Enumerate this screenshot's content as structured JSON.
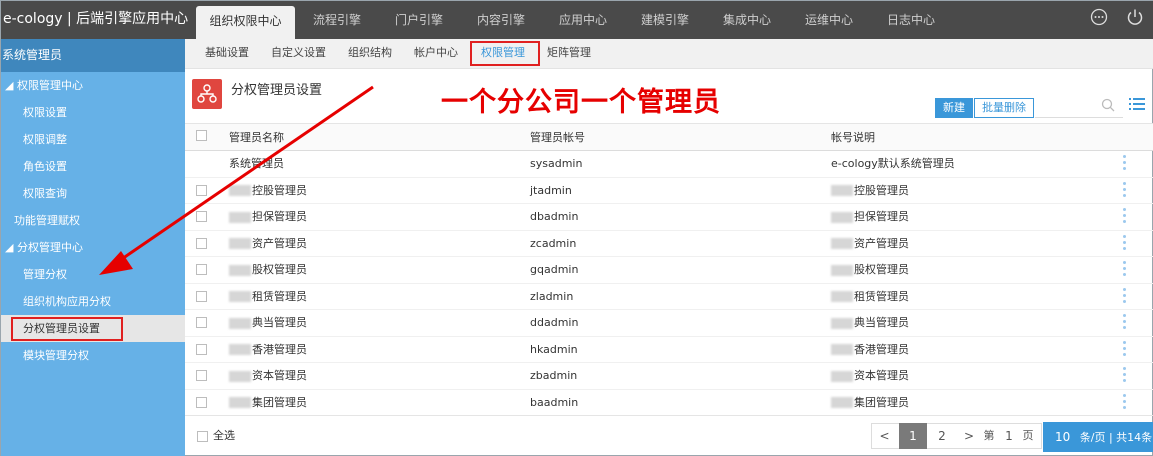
{
  "brand": "e-cology | 后端引擎应用中心",
  "top_tabs": [
    "组织权限中心",
    "流程引擎",
    "门户引擎",
    "内容引擎",
    "应用中心",
    "建模引擎",
    "集成中心",
    "运维中心",
    "日志中心"
  ],
  "sidebar": {
    "header": "系统管理员",
    "items": [
      {
        "label": "◢ 权限管理中心"
      },
      {
        "label": "权限设置"
      },
      {
        "label": "权限调整"
      },
      {
        "label": "角色设置"
      },
      {
        "label": "权限查询"
      },
      {
        "label": "功能管理赋权"
      },
      {
        "label": "◢ 分权管理中心"
      },
      {
        "label": "管理分权"
      },
      {
        "label": "组织机构应用分权"
      },
      {
        "label": "分权管理员设置"
      },
      {
        "label": "模块管理分权"
      }
    ]
  },
  "sub_tabs": [
    "基础设置",
    "自定义设置",
    "组织结构",
    "帐户中心",
    "权限管理",
    "矩阵管理"
  ],
  "page": {
    "title": "分权管理员设置",
    "annotation": "一个分公司一个管理员",
    "new_button": "新建",
    "batch_delete_button": "批量删除",
    "search_placeholder": ""
  },
  "table": {
    "columns": [
      "管理员名称",
      "管理员帐号",
      "帐号说明"
    ],
    "rows": [
      {
        "name": "系统管理员",
        "account": "sysadmin",
        "desc": "e-cology默认系统管理员"
      },
      {
        "name": "控股管理员",
        "account": "jtadmin",
        "desc": "控股管理员"
      },
      {
        "name": "担保管理员",
        "account": "dbadmin",
        "desc": "担保管理员"
      },
      {
        "name": "资产管理员",
        "account": "zcadmin",
        "desc": "资产管理员"
      },
      {
        "name": "股权管理员",
        "account": "gqadmin",
        "desc": "股权管理员"
      },
      {
        "name": "租赁管理员",
        "account": "zladmin",
        "desc": "租赁管理员"
      },
      {
        "name": "典当管理员",
        "account": "ddadmin",
        "desc": "典当管理员"
      },
      {
        "name": "香港管理员",
        "account": "hkadmin",
        "desc": "香港管理员"
      },
      {
        "name": "资本管理员",
        "account": "zbadmin",
        "desc": "资本管理员"
      },
      {
        "name": "集团管理员",
        "account": "baadmin",
        "desc": "集团管理员"
      }
    ]
  },
  "footer": {
    "select_all": "全选",
    "prev": "<",
    "page1": "1",
    "page2": "2",
    "next": ">",
    "goto_prefix": "第",
    "goto_value": "1",
    "goto_suffix": "页",
    "page_size": "10",
    "page_size_suffix": "条/页 | 共14条"
  },
  "colors": {
    "accent": "#3a97d9",
    "annotation": "#e60000",
    "sidebar": "#66b1e7",
    "topbar": "#4a4a4a"
  }
}
